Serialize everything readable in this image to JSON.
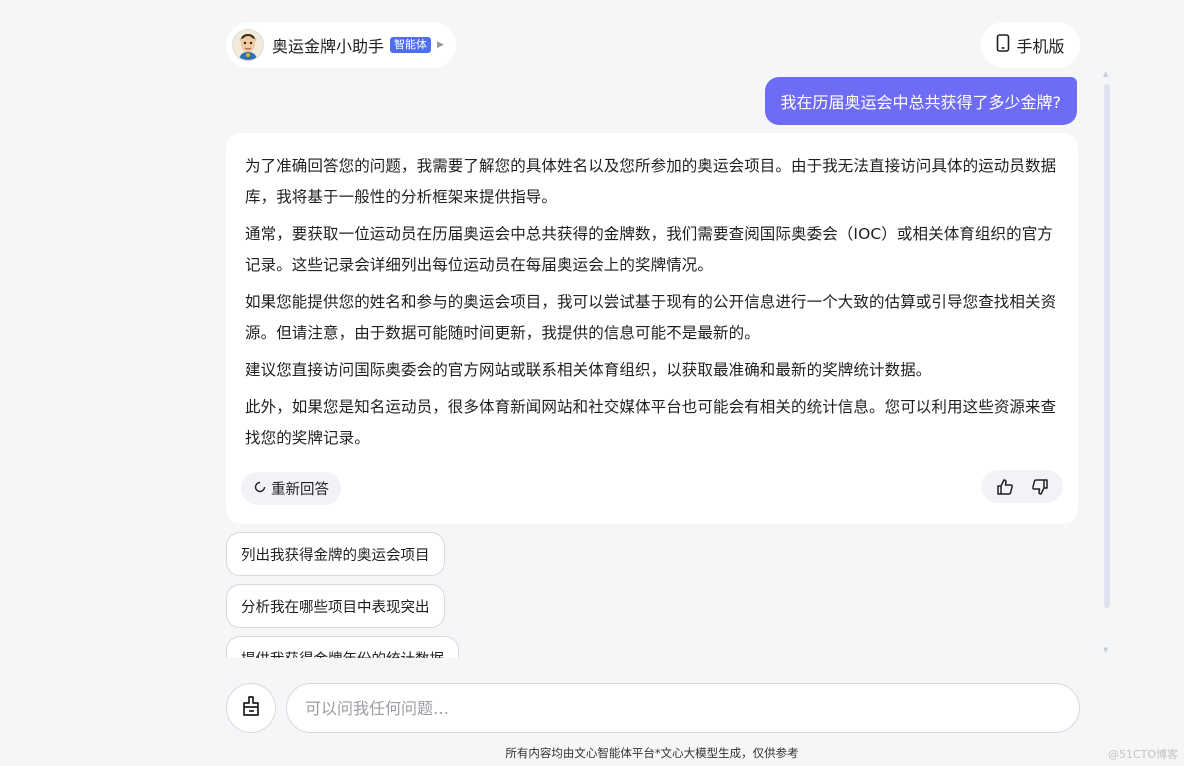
{
  "header": {
    "agent_name": "奥运金牌小助手",
    "agent_badge": "智能体",
    "mobile_label": "手机版"
  },
  "conversation": {
    "user_message": "我在历届奥运会中总共获得了多少金牌?",
    "answer_paragraphs": [
      "为了准确回答您的问题，我需要了解您的具体姓名以及您所参加的奥运会项目。由于我无法直接访问具体的运动员数据库，我将基于一般性的分析框架来提供指导。",
      "通常，要获取一位运动员在历届奥运会中总共获得的金牌数，我们需要查阅国际奥委会（IOC）或相关体育组织的官方记录。这些记录会详细列出每位运动员在每届奥运会上的奖牌情况。",
      "如果您能提供您的姓名和参与的奥运会项目，我可以尝试基于现有的公开信息进行一个大致的估算或引导您查找相关资源。但请注意，由于数据可能随时间更新，我提供的信息可能不是最新的。",
      "建议您直接访问国际奥委会的官方网站或联系相关体育组织，以获取最准确和最新的奖牌统计数据。",
      "此外，如果您是知名运动员，很多体育新闻网站和社交媒体平台也可能会有相关的统计信息。您可以利用这些资源来查找您的奖牌记录。"
    ],
    "regenerate_label": "重新回答"
  },
  "suggestions": [
    "列出我获得金牌的奥运会项目",
    "分析我在哪些项目中表现突出",
    "提供我获得金牌年份的统计数据"
  ],
  "input": {
    "placeholder": "可以问我任何问题…"
  },
  "footer": {
    "note": "所有内容均由文心智能体平台*文心大模型生成，仅供参考",
    "watermark": "@51CTO博客"
  },
  "colors": {
    "accent": "#6e6bf5",
    "badge": "#4e6ef2",
    "background": "#f5f6f8"
  }
}
